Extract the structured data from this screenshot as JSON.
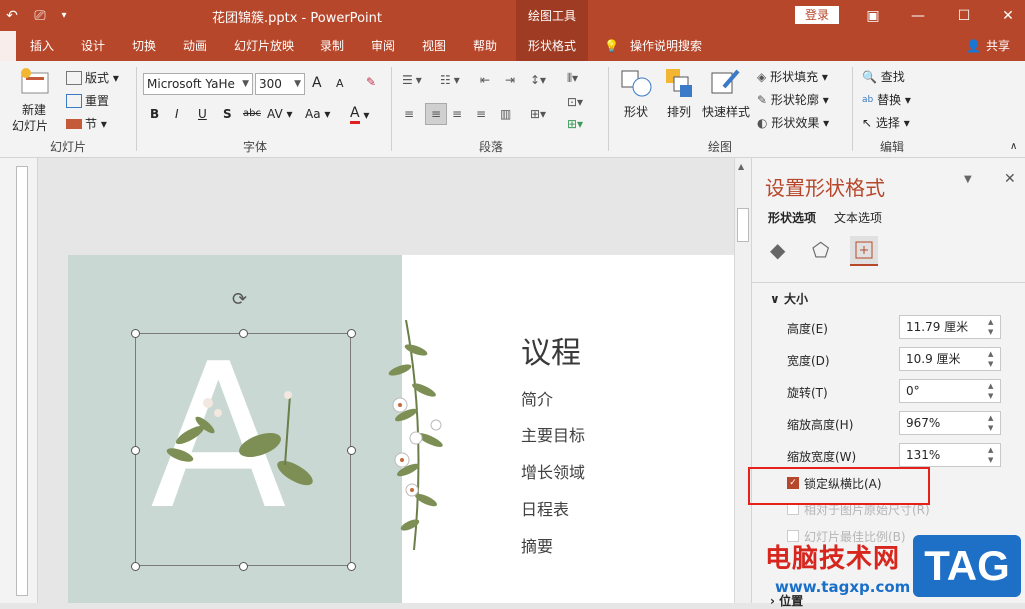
{
  "titlebar": {
    "title": "花团锦簇.pptx  -  PowerPoint",
    "contextual_tab_group": "绘图工具",
    "login_label": "登录"
  },
  "menu": {
    "tabs": [
      "插入",
      "设计",
      "切换",
      "动画",
      "幻灯片放映",
      "录制",
      "审阅",
      "视图",
      "帮助",
      "形状格式"
    ],
    "active_tab": "形状格式",
    "tell_me": "操作说明搜索",
    "share": "共享"
  },
  "ribbon": {
    "slides_group": {
      "label": "幻灯片",
      "new_slide_line1": "新建",
      "new_slide_line2": "幻灯片",
      "layout": "版式",
      "reset": "重置",
      "section": "节"
    },
    "font_group": {
      "label": "字体",
      "font_name": "Microsoft YaHe",
      "font_size": "300",
      "bold": "B",
      "italic": "I",
      "underline": "U",
      "shadow": "S",
      "strike": "abc",
      "spacing": "AV",
      "case": "Aa",
      "increase": "A",
      "decrease": "A",
      "color_a": "A"
    },
    "paragraph_group": {
      "label": "段落"
    },
    "drawing_group": {
      "label": "绘图",
      "shapes": "形状",
      "arrange": "排列",
      "quick_styles": "快速样式",
      "fill": "形状填充",
      "outline": "形状轮廓",
      "effects": "形状效果"
    },
    "editing_group": {
      "label": "编辑",
      "find": "查找",
      "replace": "替换",
      "select": "选择"
    }
  },
  "slide": {
    "letter": "A",
    "agenda_title": "议程",
    "agenda_items": [
      "简介",
      "主要目标",
      "增长领域",
      "日程表",
      "摘要"
    ]
  },
  "pane": {
    "title": "设置形状格式",
    "tab_shape": "形状选项",
    "tab_text": "文本选项",
    "section_size": "大小",
    "height_label": "高度(E)",
    "height_value": "11.79 厘米",
    "width_label": "宽度(D)",
    "width_value": "10.9 厘米",
    "rotation_label": "旋转(T)",
    "rotation_value": "0°",
    "scale_h_label": "缩放高度(H)",
    "scale_h_value": "967%",
    "scale_w_label": "缩放宽度(W)",
    "scale_w_value": "131%",
    "lock_aspect_label": "锁定纵横比(A)",
    "relative_label": "相对于图片原始尺寸(R)",
    "best_scale_label": "幻灯片最佳比例(B)",
    "position_label": "位置"
  },
  "watermark": {
    "line1": "电脑技术网",
    "line2": "www.tagxp.com",
    "tag": "TAG"
  }
}
